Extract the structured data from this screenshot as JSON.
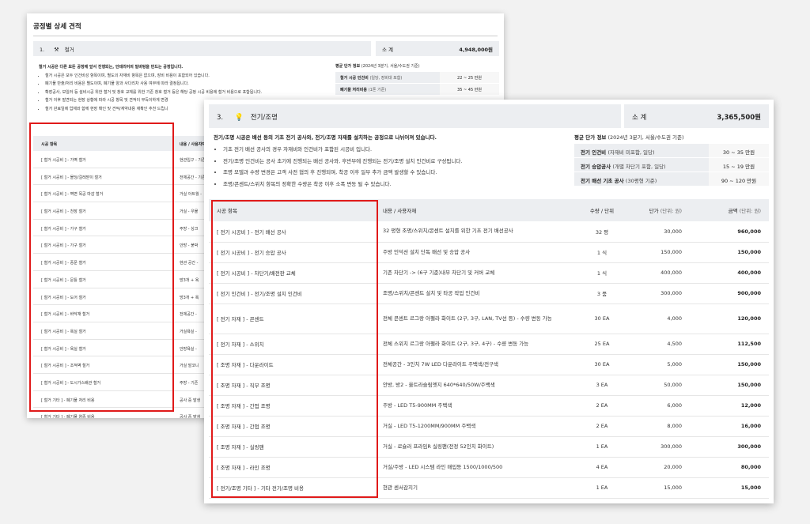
{
  "back": {
    "title": "공정별 상세 견적",
    "section_num": "1.",
    "section_icon": "hammer-icon",
    "section_title": "철거",
    "summary_label": "소 계",
    "summary_value": "4,948,000원",
    "lead": "철거 시공은 다른 모든 공정에 앞서 진행되는, 인테리어의 밑바탕을 만드는 공정입니다.",
    "bullets": [
      "철거 시공은 모두 인건비성 항목이며, 별도의 자재비 항목은 없으며, 장비 비용이 포함되어 있습니다.",
      "폐기물 반출/처리 비용은 별도이며, 폐기물 양과 사다리차 사용 여부에 따라 결정됩니다.",
      "확장공사, 보일러 등 설비시공 위한 철거 및 창호 교체를 위한 기존 창호 철거 등은 해당 공정 시공 비용에 철거 비용으로 포함됩니다.",
      "철거 이후 발견되는 현장 상황에 따라 시공 항목 및 견적이 부득이하게 변경",
      "철거 완료일에 업체와 함께 현장 확인 및 견적/계약내용 재확인 추천 드립니"
    ],
    "avg_title": "평균 단가 정보",
    "avg_note": "(2024년 3분기, 서울/수도권 기준)",
    "avg_rows": [
      {
        "k": "철거 시공 인건비",
        "note": "(일당, 장비대 포함)",
        "v": "22 ~ 25 만원"
      },
      {
        "k": "폐기물 처리비용",
        "note": "(1톤 기준)",
        "v": "35 ~ 45 만원"
      }
    ],
    "th_item": "시공 항목",
    "th_content": "내용 / 사용자재",
    "rows": [
      {
        "a": "[ 철거 시공비 ] - 가벽 철거",
        "b": "현관입구 - 기존"
      },
      {
        "a": "[ 철거 시공비 ] - 몰딩/걸레받이 철거",
        "b": "전체공간 - 기존"
      },
      {
        "a": "[ 철거 시공비 ] - 벽면 목공 마감 철거",
        "b": "거실 아트월 -"
      },
      {
        "a": "[ 철거 시공비 ] - 천장 철거",
        "b": "거실 - 우물"
      },
      {
        "a": "[ 철거 시공비 ] - 가구 철거",
        "b": "주방 - 싱크"
      },
      {
        "a": "[ 철거 시공비 ] - 가구 철거",
        "b": "안방 - 붙박"
      },
      {
        "a": "[ 철거 시공비 ] - 중문 철거",
        "b": "현관 공간 -"
      },
      {
        "a": "[ 철거 시공비 ] - 문틀 철거",
        "b": "방3개 + 욕"
      },
      {
        "a": "[ 철거 시공비 ] - 도어 철거",
        "b": "방3개 + 욕"
      },
      {
        "a": "[ 철거 시공비 ] - 바닥재 철거",
        "b": "전체공간 -"
      },
      {
        "a": "[ 철거 시공비 ] - 욕실 철거",
        "b": "거실욕실 -"
      },
      {
        "a": "[ 철거 시공비 ] - 욕실 철거",
        "b": "안방욕실 -"
      },
      {
        "a": "[ 철거 시공비 ] - 조적벽 철거",
        "b": "거실 발코니"
      },
      {
        "a": "[ 철거 시공비 ] - 도시가스배관 철거",
        "b": "주방 - 기존"
      },
      {
        "a": "[ 철거 기타 ] - 폐기물 처리 비용",
        "b": "공사 중 발생"
      },
      {
        "a": "[ 철거 기타 ] - 폐기물 양중 비용",
        "b": "공사 중 발생"
      }
    ]
  },
  "front": {
    "section_num": "3.",
    "section_icon": "lightbulb-icon",
    "section_title": "전기/조명",
    "summary_label": "소 계",
    "summary_value": "3,365,500원",
    "lead": "전기/조명 시공은 배선 등의 기초 전기 공사와, 전기/조명 자재를 설치하는 공정으로 나뉘어져 있습니다.",
    "bullets": [
      "기초 전기 배선 공사의 경우 자재비와 인건비가 포함된 시공비 입니다.",
      "전기/조명 인건비는 공사 초기에 진행되는 배선 공사와, 후반부에 진행되는 전기/조명 설치 인건비로 구성됩니다.",
      "조명 모델과 수량 변경은 고객 사전 협의 후 진행되며, 착공 이후 일부 추가 금액 발생할 수 있습니다.",
      "조명/콘센트/스위치 항목의 정확한 수량은 착공 이후 소폭 변동 될 수 있습니다."
    ],
    "avg_title": "평균 단가 정보",
    "avg_note": "(2024년 3분기, 서울/수도권 기준)",
    "avg_rows": [
      {
        "k": "전기 인건비",
        "note": "(자재비 미포함, 일당)",
        "v": "30 ~ 35 만원"
      },
      {
        "k": "전기 승압공사",
        "note": "(개별 차단기 포함, 일당)",
        "v": "15 ~ 19 만원"
      },
      {
        "k": "전기 배선 기초 공사",
        "note": "(30평형 기준)",
        "v": "90 ~ 120 만원"
      }
    ],
    "th": {
      "item": "시공 항목",
      "content": "내용 / 사용자재",
      "qty": "수량 / 단위",
      "price": "단가",
      "price_unit": "(단위: 원)",
      "amount": "금액",
      "amount_unit": "(단위: 원)"
    },
    "rows": [
      {
        "item": "[ 전기 시공비 ] - 전기 배선 공사",
        "content": "32 평형 조명/스위치/콘센트 설치를 위한 기초 전기 배선공사",
        "qty": "32 평",
        "price": "30,000",
        "amount": "960,000"
      },
      {
        "item": "[ 전기 시공비 ] - 전기 승압 공사",
        "content": "주방 인덕션 설치 단독 배선 및 승압 공사",
        "qty": "1 식",
        "price": "150,000",
        "amount": "150,000"
      },
      {
        "item": "[ 전기 시공비 ] - 차단기/배전판 교체",
        "content": "기존 차단기 -> (6구 기준)내부 차단기 및 커버 교체",
        "qty": "1 식",
        "price": "400,000",
        "amount": "400,000"
      },
      {
        "item": "[ 전기 인건비 ] - 전기/조명 설치 인건비",
        "content": "조명/스위치/콘센트 설치 및 타공 작업 인건비",
        "qty": "3 품",
        "price": "300,000",
        "amount": "900,000"
      },
      {
        "item": "[ 전기 자재 ] - 콘센트",
        "content": "전체 콘센트 르그랑 아펠라 화이트 (2구, 3구, LAN, TV선 등) - 수량 변동 가능",
        "qty": "30 EA",
        "price": "4,000",
        "amount": "120,000"
      },
      {
        "item": "[ 전기 자재 ] - 스위치",
        "content": "전체 스위치 르그랑 아펠라 화이트 (2구, 3구, 4구) - 수량 변동 가능",
        "qty": "25 EA",
        "price": "4,500",
        "amount": "112,500"
      },
      {
        "item": "[ 조명 자재 ] - 다운라이트",
        "content": "전체공간 - 3인치 7W LED 다운라이트 주백색/전구색",
        "qty": "30 EA",
        "price": "5,000",
        "amount": "150,000"
      },
      {
        "item": "[ 조명 자재 ] - 직부 조명",
        "content": "안방, 방2 - 울트라슬림엣지 640*640/50W/주백색",
        "qty": "3 EA",
        "price": "50,000",
        "amount": "150,000"
      },
      {
        "item": "[ 조명 자재 ] - 간접 조명",
        "content": "주방 - LED T5-900MM 주백색",
        "qty": "2 EA",
        "price": "6,000",
        "amount": "12,000"
      },
      {
        "item": "[ 조명 자재 ] - 간접 조명",
        "content": "거실 - LED T5-1200MM/900MM 주백색",
        "qty": "2 EA",
        "price": "8,000",
        "amount": "16,000"
      },
      {
        "item": "[ 조명 자재 ] - 실링팬",
        "content": "거실 - 로슐러 프라임R 실링팬(전정 52인치 화이트)",
        "qty": "1 EA",
        "price": "300,000",
        "amount": "300,000"
      },
      {
        "item": "[ 조명 자재 ] - 라인 조명",
        "content": "거실/주방 - LED 시스템 라인 매입등 1500/1000/500",
        "qty": "4 EA",
        "price": "20,000",
        "amount": "80,000"
      },
      {
        "item": "[ 전기/조명 기타 ] - 기타 전기/조명 비용",
        "content": "현관 센서감지기",
        "qty": "1 EA",
        "price": "15,000",
        "amount": "15,000"
      }
    ]
  },
  "highlight_color": "#e01a1a"
}
